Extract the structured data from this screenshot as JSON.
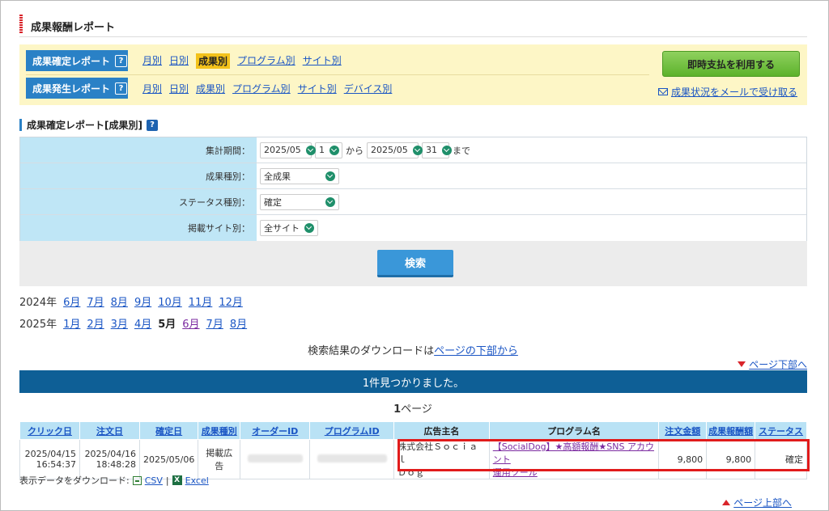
{
  "page": {
    "title": "成果報酬レポート"
  },
  "report_nav": {
    "confirmed": {
      "label": "成果確定レポート",
      "help": "?",
      "links": [
        "月別",
        "日別",
        "成果別",
        "プログラム別",
        "サイト別"
      ],
      "active": "成果別"
    },
    "occurred": {
      "label": "成果発生レポート",
      "help": "?",
      "links": [
        "月別",
        "日別",
        "成果別",
        "プログラム別",
        "サイト別",
        "デバイス別"
      ]
    },
    "pay_button": "即時支払を利用する",
    "mail_link": "成果状況をメールで受け取る"
  },
  "section": {
    "heading": "成果確定レポート[成果別]",
    "help": "?"
  },
  "form": {
    "period": {
      "label": "集計期間：",
      "from_month": "2025/05",
      "from_day": "1",
      "from_text": "から",
      "to_month": "2025/05",
      "to_day": "31",
      "to_text": "まで"
    },
    "type": {
      "label": "成果種別：",
      "value": "全成果"
    },
    "status": {
      "label": "ステータス種別：",
      "value": "確定"
    },
    "site": {
      "label": "掲載サイト別：",
      "value": "全サイト"
    },
    "search_button": "検索"
  },
  "months": {
    "y2024": {
      "year": "2024年",
      "items": [
        "6月",
        "7月",
        "8月",
        "9月",
        "10月",
        "11月",
        "12月"
      ]
    },
    "y2025": {
      "year": "2025年",
      "items": [
        "1月",
        "2月",
        "3月",
        "4月",
        "5月",
        "6月",
        "7月",
        "8月"
      ],
      "current": "5月",
      "visited": "6月"
    }
  },
  "download_note": {
    "text": "検索結果のダウンロードは",
    "link": "ページの下部から"
  },
  "to_bottom": "ページ下部へ",
  "result_banner": "1件見つかりました。",
  "page_indicator": {
    "num": "1",
    "suffix": "ページ"
  },
  "table": {
    "headers": [
      "クリック日",
      "注文日",
      "確定日",
      "成果種別",
      "オーダーID",
      "プログラムID",
      "広告主名",
      "プログラム名",
      "注文金額",
      "成果報酬額",
      "ステータス"
    ],
    "rows": [
      {
        "click_date": "2025/04/15",
        "click_time": "16:54:37",
        "order_date": "2025/04/16",
        "order_time": "18:48:28",
        "confirm_date": "2025/05/06",
        "type": "掲載広告",
        "advertiser_line1": "株式会社Ｓｏｃｉａｌ",
        "advertiser_line2": "Ｄｏｇ",
        "program_line1": "【SocialDog】★高額報酬★SNS アカウント",
        "program_line2": "運用ツール",
        "order_amount": "9,800",
        "reward": "9,800",
        "status": "確定"
      }
    ]
  },
  "download_row": {
    "label": "表示データをダウンロード:",
    "csv": "CSV",
    "sep": "|",
    "excel": "Excel"
  },
  "to_top": "ページ上部へ",
  "colors": {
    "accent_blue": "#2a81c6",
    "banner": "#0e5f96",
    "highlight_red": "#e11b1b",
    "nav_bg": "#fdf6c6"
  }
}
